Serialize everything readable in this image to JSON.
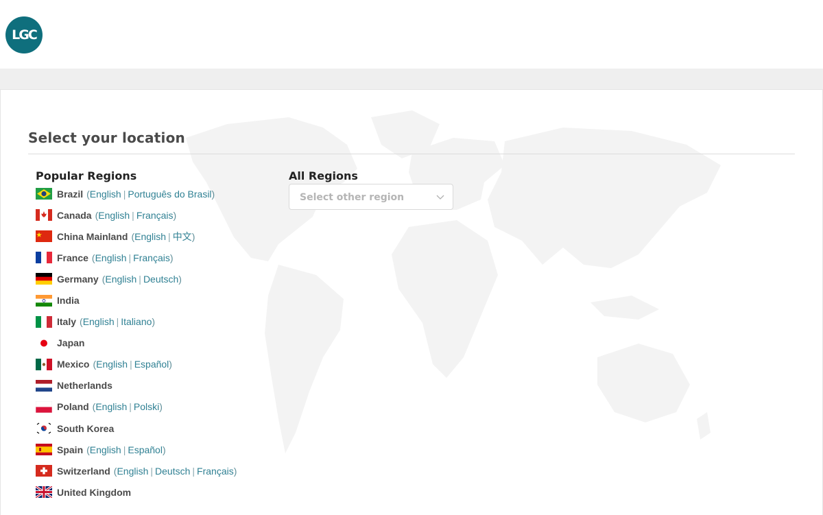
{
  "brand": {
    "logo_text": "LGC"
  },
  "page": {
    "title": "Select your location",
    "popular_heading": "Popular Regions",
    "all_heading": "All Regions"
  },
  "region_select": {
    "placeholder": "Select other region"
  },
  "countries": [
    {
      "name": "Brazil",
      "flag": "brazil-flag-icon",
      "languages": [
        "English",
        "Português do Brasil"
      ]
    },
    {
      "name": "Canada",
      "flag": "canada-flag-icon",
      "languages": [
        "English",
        "Français"
      ]
    },
    {
      "name": "China Mainland",
      "flag": "china-flag-icon",
      "languages": [
        "English",
        "中文"
      ]
    },
    {
      "name": "France",
      "flag": "france-flag-icon",
      "languages": [
        "English",
        "Français"
      ]
    },
    {
      "name": "Germany",
      "flag": "germany-flag-icon",
      "languages": [
        "English",
        "Deutsch"
      ]
    },
    {
      "name": "India",
      "flag": "india-flag-icon",
      "languages": []
    },
    {
      "name": "Italy",
      "flag": "italy-flag-icon",
      "languages": [
        "English",
        "Italiano"
      ]
    },
    {
      "name": "Japan",
      "flag": "japan-flag-icon",
      "languages": []
    },
    {
      "name": "Mexico",
      "flag": "mexico-flag-icon",
      "languages": [
        "English",
        "Español"
      ]
    },
    {
      "name": "Netherlands",
      "flag": "netherlands-flag-icon",
      "languages": []
    },
    {
      "name": "Poland",
      "flag": "poland-flag-icon",
      "languages": [
        "English",
        "Polski"
      ]
    },
    {
      "name": "South Korea",
      "flag": "south-korea-flag-icon",
      "languages": []
    },
    {
      "name": "Spain",
      "flag": "spain-flag-icon",
      "languages": [
        "English",
        "Español"
      ]
    },
    {
      "name": "Switzerland",
      "flag": "switzerland-flag-icon",
      "languages": [
        "English",
        "Deutsch",
        "Français"
      ]
    },
    {
      "name": "United Kingdom",
      "flag": "uk-flag-icon",
      "languages": []
    }
  ]
}
